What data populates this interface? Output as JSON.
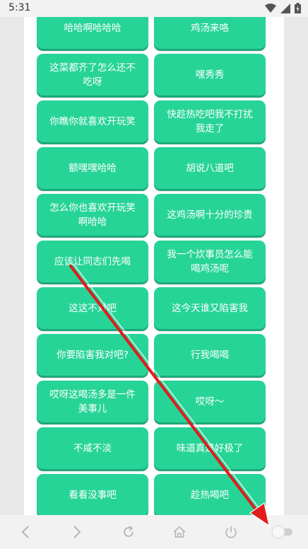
{
  "status_bar": {
    "time": "5:31"
  },
  "phrases": [
    "哈哈啊哈哈哈",
    "鸡汤来咯",
    "这菜都齐了怎么还不吃呀",
    "嘿秀秀",
    "你瞧你就喜欢开玩笑",
    "快趁热吃吧我不打扰我走了",
    "额嘿嘿哈哈",
    "胡说八道吧",
    "怎么你也喜欢开玩笑啊哈哈",
    "这鸡汤啊十分的珍贵",
    "应该让同志们先喝",
    "我一个炊事员怎么能喝鸡汤呢",
    "这这不对吧",
    "这今天谁又陷害我",
    "你要陷害我对吧?",
    "行我喝喝",
    "哎呀这喝汤多是一件美事儿",
    "哎呀～",
    "不咸不淡",
    "味道真是好极了",
    "看看没事吧",
    "趁热喝吧"
  ],
  "colors": {
    "button": "#27d497",
    "arrow": "#e21b1b"
  }
}
